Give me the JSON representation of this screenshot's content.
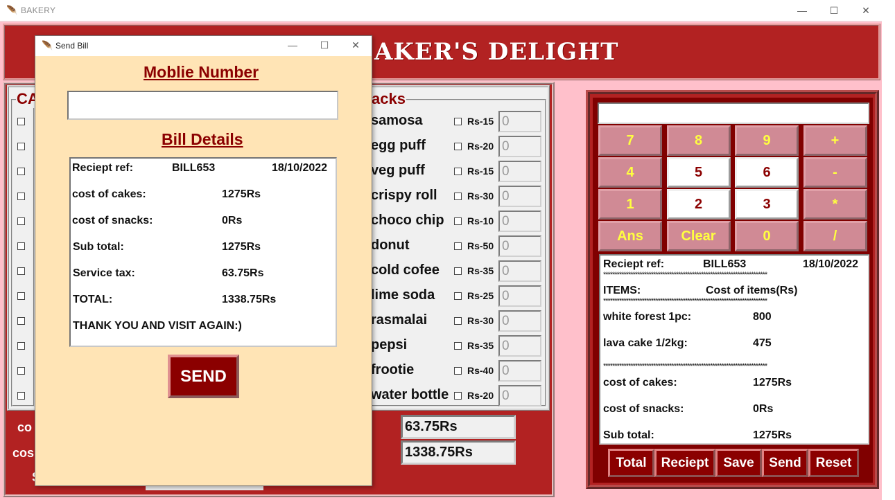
{
  "window": {
    "title": "BAKERY",
    "minimize_icon": "minimize-icon",
    "maximize_icon": "maximize-icon",
    "close_icon": "close-icon"
  },
  "app": {
    "header_visible_text": "AKER'S DELIGHT",
    "header_color": "#b22222",
    "background_color": "#ffc0cb"
  },
  "cakes": {
    "legend_visible": "CA",
    "row_count": 12
  },
  "snacks": {
    "legend_visible": "acks",
    "items": [
      {
        "name": "samosa",
        "price": "Rs-15",
        "qty": "0"
      },
      {
        "name": "egg puff",
        "price": "Rs-20",
        "qty": "0"
      },
      {
        "name": "veg puff",
        "price": "Rs-15",
        "qty": "0"
      },
      {
        "name": "crispy roll",
        "price": "Rs-30",
        "qty": "0"
      },
      {
        "name": "choco chip",
        "price": "Rs-10",
        "qty": "0"
      },
      {
        "name": "donut",
        "price": "Rs-50",
        "qty": "0"
      },
      {
        "name": "cold cofee",
        "price": "Rs-35",
        "qty": "0"
      },
      {
        "name": "lime soda",
        "price": "Rs-25",
        "qty": "0"
      },
      {
        "name": "rasmalai",
        "price": "Rs-30",
        "qty": "0"
      },
      {
        "name": "pepsi",
        "price": "Rs-35",
        "qty": "0"
      },
      {
        "name": "frootie",
        "price": "Rs-40",
        "qty": "0"
      },
      {
        "name": "water bottle",
        "price": "Rs-20",
        "qty": "0"
      }
    ]
  },
  "totals": {
    "labels": [
      "co",
      "cos",
      "S"
    ],
    "service_tax": "63.75Rs",
    "total": "1338.75Rs"
  },
  "calculator": {
    "display": "",
    "buttons": [
      {
        "label": "7",
        "style": "pink"
      },
      {
        "label": "8",
        "style": "pink"
      },
      {
        "label": "9",
        "style": "pink"
      },
      {
        "label": "+",
        "style": "pink"
      },
      {
        "label": "4",
        "style": "pink"
      },
      {
        "label": "5",
        "style": "white"
      },
      {
        "label": "6",
        "style": "white"
      },
      {
        "label": "-",
        "style": "pink"
      },
      {
        "label": "1",
        "style": "pink"
      },
      {
        "label": "2",
        "style": "white"
      },
      {
        "label": "3",
        "style": "white"
      },
      {
        "label": "*",
        "style": "pink"
      },
      {
        "label": "Ans",
        "style": "pink"
      },
      {
        "label": "Clear",
        "style": "pink"
      },
      {
        "label": "0",
        "style": "pink"
      },
      {
        "label": "/",
        "style": "pink"
      }
    ]
  },
  "receipt": {
    "ref_label": "Reciept ref:",
    "ref_value": "BILL653",
    "date": "18/10/2022",
    "stars": "************************************************************************",
    "items_label": "ITEMS:",
    "cost_header": "Cost of items(Rs)",
    "lines": [
      {
        "name": "white forest 1pc:",
        "value": "800"
      },
      {
        "name": "lava cake 1/2kg:",
        "value": "475"
      }
    ],
    "cost_cakes_label": "cost of cakes:",
    "cost_cakes": "1275Rs",
    "cost_snacks_label": "cost of snacks:",
    "cost_snacks": "0Rs",
    "subtotal_label": "Sub total:",
    "subtotal": "1275Rs"
  },
  "bottom_buttons": [
    "Total",
    "Reciept",
    "Save",
    "Send",
    "Reset"
  ],
  "dialog": {
    "title": "Send Bill",
    "mobile_heading": "Moblie Number",
    "mobile_value": "",
    "bill_heading": "Bill Details",
    "bill": {
      "ref_label": "Reciept ref:",
      "ref_value": "BILL653",
      "date": "18/10/2022",
      "cakes_label": "cost of cakes:",
      "cakes_value": "1275Rs",
      "snacks_label": "cost of snacks:",
      "snacks_value": "0Rs",
      "subtotal_label": "Sub total:",
      "subtotal_value": "1275Rs",
      "tax_label": "Service tax:",
      "tax_value": "63.75Rs",
      "total_label": "TOTAL:",
      "total_value": "1338.75Rs",
      "thanks": "THANK YOU AND VISIT AGAIN:)"
    },
    "send_label": "SEND"
  }
}
